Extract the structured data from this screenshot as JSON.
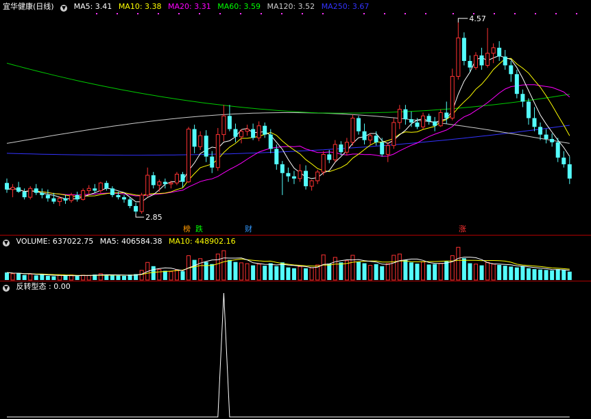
{
  "title": "宜华健康(日线)",
  "legend_price": [
    {
      "label": "MA5: 3.41",
      "color": "#ffffff"
    },
    {
      "label": "MA10: 3.38",
      "color": "#ffff00"
    },
    {
      "label": "MA20: 3.31",
      "color": "#ff00ff"
    },
    {
      "label": "MA60: 3.59",
      "color": "#00ff00"
    },
    {
      "label": "MA120: 3.52",
      "color": "#cccccc"
    },
    {
      "label": "MA250: 3.67",
      "color": "#3333ff"
    }
  ],
  "legend_volume": [
    {
      "label": "VOLUME: 637022.75",
      "color": "#ffffff"
    },
    {
      "label": "MA5: 406584.38",
      "color": "#ffffff"
    },
    {
      "label": "MA10: 448902.16",
      "color": "#ffff00"
    }
  ],
  "legend_indicator": [
    {
      "label": "反转型态 : 0.00",
      "color": "#ffffff"
    }
  ],
  "markers": [
    {
      "text": "榜",
      "color": "#ff9900"
    },
    {
      "text": "跌",
      "color": "#00ff00"
    },
    {
      "text": "财",
      "color": "#3399ff"
    },
    {
      "text": "涨",
      "color": "#ff3333"
    }
  ],
  "colors": {
    "up": "#ff3232",
    "down": "#54fcfc",
    "background": "#000000",
    "divider": "#b00000"
  },
  "chart_data": {
    "type": "candlestick",
    "ylim": [
      2.75,
      4.65
    ],
    "high_label": "4.57",
    "low_label": "2.85",
    "ohlc": [
      [
        3.11,
        3.15,
        3.02,
        3.05
      ],
      [
        3.05,
        3.1,
        2.98,
        3.07
      ],
      [
        3.07,
        3.12,
        3.02,
        3.03
      ],
      [
        3.03,
        3.06,
        2.96,
        2.98
      ],
      [
        2.98,
        3.08,
        2.96,
        3.06
      ],
      [
        3.06,
        3.1,
        3.0,
        3.02
      ],
      [
        3.02,
        3.06,
        2.97,
        3.0
      ],
      [
        3.0,
        3.05,
        2.94,
        2.97
      ],
      [
        2.97,
        3.02,
        2.92,
        2.94
      ],
      [
        2.94,
        2.99,
        2.9,
        2.97
      ],
      [
        2.97,
        3.0,
        2.92,
        2.95
      ],
      [
        2.95,
        3.02,
        2.93,
        3.0
      ],
      [
        3.0,
        3.03,
        2.94,
        2.96
      ],
      [
        2.96,
        3.06,
        2.95,
        3.04
      ],
      [
        3.04,
        3.09,
        3.0,
        3.06
      ],
      [
        3.06,
        3.1,
        3.02,
        3.04
      ],
      [
        3.04,
        3.12,
        3.02,
        3.11
      ],
      [
        3.11,
        3.13,
        3.04,
        3.06
      ],
      [
        3.06,
        3.08,
        2.98,
        3.0
      ],
      [
        3.0,
        3.03,
        2.96,
        2.98
      ],
      [
        2.98,
        3.0,
        2.93,
        2.96
      ],
      [
        2.96,
        2.98,
        2.88,
        2.9
      ],
      [
        2.9,
        2.93,
        2.83,
        2.85
      ],
      [
        2.85,
        3.02,
        2.83,
        3.0
      ],
      [
        3.0,
        3.25,
        2.98,
        3.18
      ],
      [
        3.18,
        3.21,
        3.06,
        3.09
      ],
      [
        3.09,
        3.14,
        3.03,
        3.12
      ],
      [
        3.12,
        3.15,
        3.06,
        3.1
      ],
      [
        3.1,
        3.13,
        3.06,
        3.11
      ],
      [
        3.11,
        3.21,
        3.09,
        3.19
      ],
      [
        3.19,
        3.21,
        3.07,
        3.12
      ],
      [
        3.12,
        3.62,
        3.11,
        3.6
      ],
      [
        3.6,
        3.64,
        3.38,
        3.44
      ],
      [
        3.44,
        3.58,
        3.41,
        3.54
      ],
      [
        3.54,
        3.59,
        3.3,
        3.35
      ],
      [
        3.35,
        3.4,
        3.2,
        3.25
      ],
      [
        3.25,
        3.61,
        3.22,
        3.55
      ],
      [
        3.55,
        3.82,
        3.49,
        3.72
      ],
      [
        3.72,
        3.82,
        3.58,
        3.6
      ],
      [
        3.6,
        3.65,
        3.48,
        3.53
      ],
      [
        3.53,
        3.6,
        3.47,
        3.58
      ],
      [
        3.58,
        3.64,
        3.54,
        3.6
      ],
      [
        3.6,
        3.65,
        3.5,
        3.52
      ],
      [
        3.52,
        3.67,
        3.49,
        3.63
      ],
      [
        3.63,
        3.66,
        3.52,
        3.55
      ],
      [
        3.55,
        3.6,
        3.38,
        3.42
      ],
      [
        3.42,
        3.46,
        3.23,
        3.28
      ],
      [
        3.28,
        3.31,
        3.0,
        3.2
      ],
      [
        3.2,
        3.25,
        3.12,
        3.17
      ],
      [
        3.17,
        3.22,
        3.1,
        3.15
      ],
      [
        3.15,
        3.28,
        3.12,
        3.22
      ],
      [
        3.22,
        3.27,
        3.05,
        3.08
      ],
      [
        3.08,
        3.14,
        3.04,
        3.13
      ],
      [
        3.13,
        3.23,
        3.1,
        3.21
      ],
      [
        3.21,
        3.4,
        3.18,
        3.37
      ],
      [
        3.37,
        3.41,
        3.29,
        3.32
      ],
      [
        3.32,
        3.5,
        3.3,
        3.46
      ],
      [
        3.46,
        3.49,
        3.36,
        3.39
      ],
      [
        3.39,
        3.52,
        3.36,
        3.48
      ],
      [
        3.48,
        3.73,
        3.45,
        3.7
      ],
      [
        3.7,
        3.72,
        3.55,
        3.58
      ],
      [
        3.58,
        3.65,
        3.46,
        3.5
      ],
      [
        3.5,
        3.56,
        3.46,
        3.54
      ],
      [
        3.54,
        3.58,
        3.45,
        3.48
      ],
      [
        3.48,
        3.52,
        3.35,
        3.37
      ],
      [
        3.37,
        3.48,
        3.3,
        3.45
      ],
      [
        3.45,
        3.7,
        3.42,
        3.66
      ],
      [
        3.66,
        3.82,
        3.6,
        3.78
      ],
      [
        3.78,
        3.82,
        3.64,
        3.69
      ],
      [
        3.69,
        3.76,
        3.62,
        3.66
      ],
      [
        3.66,
        3.7,
        3.6,
        3.62
      ],
      [
        3.62,
        3.75,
        3.6,
        3.72
      ],
      [
        3.72,
        3.74,
        3.64,
        3.67
      ],
      [
        3.67,
        3.71,
        3.58,
        3.63
      ],
      [
        3.63,
        3.78,
        3.62,
        3.75
      ],
      [
        3.75,
        3.85,
        3.65,
        3.7
      ],
      [
        3.7,
        4.15,
        3.68,
        4.08
      ],
      [
        4.08,
        4.57,
        4.05,
        4.43
      ],
      [
        4.43,
        4.48,
        4.18,
        4.22
      ],
      [
        4.22,
        4.27,
        4.12,
        4.16
      ],
      [
        4.16,
        4.3,
        4.14,
        4.27
      ],
      [
        4.27,
        4.34,
        4.14,
        4.18
      ],
      [
        4.18,
        4.52,
        4.16,
        4.29
      ],
      [
        4.29,
        4.38,
        4.2,
        4.34
      ],
      [
        4.34,
        4.4,
        4.22,
        4.26
      ],
      [
        4.26,
        4.32,
        4.14,
        4.18
      ],
      [
        4.18,
        4.22,
        4.03,
        4.1
      ],
      [
        4.1,
        4.14,
        3.88,
        3.92
      ],
      [
        3.92,
        3.96,
        3.8,
        3.85
      ],
      [
        3.85,
        3.88,
        3.64,
        3.7
      ],
      [
        3.7,
        3.8,
        3.58,
        3.62
      ],
      [
        3.62,
        3.66,
        3.5,
        3.55
      ],
      [
        3.55,
        3.6,
        3.47,
        3.51
      ],
      [
        3.51,
        3.56,
        3.44,
        3.48
      ],
      [
        3.48,
        3.52,
        3.3,
        3.34
      ],
      [
        3.34,
        3.4,
        3.25,
        3.28
      ],
      [
        3.28,
        3.35,
        3.1,
        3.15
      ]
    ],
    "volume": [
      180,
      150,
      160,
      120,
      140,
      110,
      130,
      100,
      90,
      110,
      100,
      120,
      95,
      115,
      110,
      130,
      150,
      120,
      110,
      105,
      100,
      130,
      140,
      230,
      420,
      330,
      250,
      220,
      200,
      240,
      210,
      580,
      480,
      510,
      430,
      380,
      620,
      700,
      480,
      430,
      410,
      390,
      350,
      380,
      340,
      400,
      330,
      420,
      300,
      280,
      320,
      280,
      290,
      360,
      600,
      390,
      540,
      420,
      460,
      590,
      430,
      400,
      350,
      380,
      330,
      390,
      590,
      620,
      480,
      420,
      390,
      430,
      370,
      380,
      400,
      450,
      580,
      780,
      520,
      400,
      380,
      350,
      420,
      380,
      360,
      340,
      320,
      300,
      330,
      280,
      260,
      250,
      240,
      230,
      260,
      240,
      200
    ],
    "reversal_pattern": {
      "spike_index": 37,
      "value_at_spike": 1,
      "current": 0.0
    }
  }
}
